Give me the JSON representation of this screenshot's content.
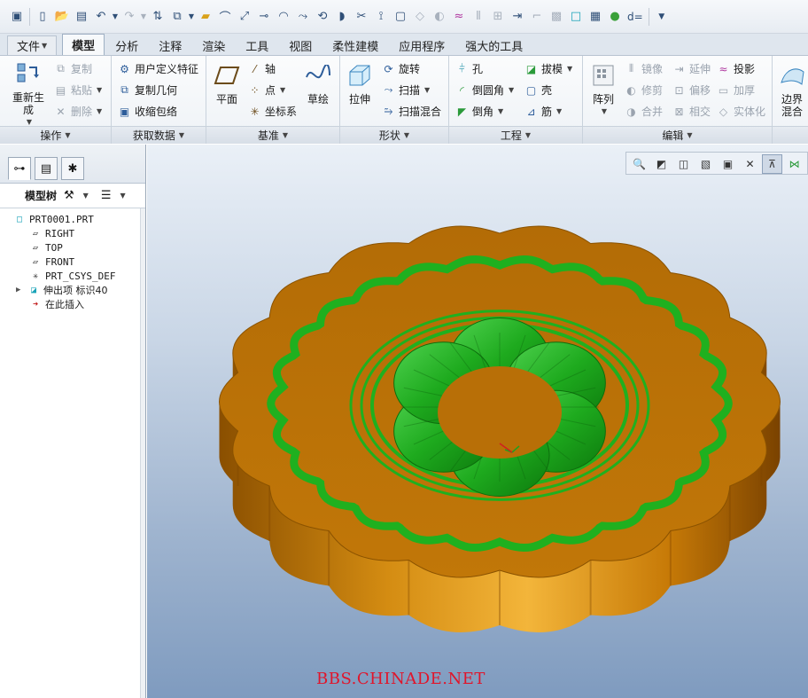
{
  "quick_access": {
    "icons": [
      "regenerate-small-icon",
      "new-icon",
      "open-icon",
      "save-icon",
      "undo-icon",
      "redo-icon",
      "regenerate-icon",
      "windows-icon",
      "folder-icon",
      "spline-icon",
      "transform-icon",
      "axis-icon",
      "surface-icon",
      "sweep-icon",
      "rotate-icon",
      "blend-icon",
      "trim-icon",
      "offset-icon",
      "copy-surf-icon",
      "wave-icon",
      "split-icon",
      "extend-icon",
      "curve-icon",
      "fill-icon",
      "cube-icon",
      "display-icon",
      "sphere-icon",
      "dimension-icon"
    ],
    "dimension_label": "d="
  },
  "tabs": [
    "文件",
    "模型",
    "分析",
    "注释",
    "渲染",
    "工具",
    "视图",
    "柔性建模",
    "应用程序",
    "强大的工具"
  ],
  "active_tab": "模型",
  "ribbon": {
    "operations": {
      "title": "操作",
      "regenerate": "重新生成",
      "copy": "复制",
      "paste": "粘贴",
      "delete": "删除"
    },
    "get_data": {
      "title": "获取数据",
      "udf": "用户定义特征",
      "copy_geom": "复制几何",
      "shrinkwrap": "收缩包络"
    },
    "datum": {
      "title": "基准",
      "plane": "平面",
      "axis": "轴",
      "point": "点",
      "csys": "坐标系",
      "sketch": "草绘"
    },
    "shapes": {
      "title": "形状",
      "extrude": "拉伸",
      "revolve": "旋转",
      "sweep": "扫描",
      "swept_blend": "扫描混合"
    },
    "engineering": {
      "title": "工程",
      "hole": "孔",
      "round": "倒圆角",
      "chamfer": "倒角",
      "draft": "拔模",
      "shell": "壳",
      "rib": "筋"
    },
    "editing": {
      "title": "编辑",
      "pattern": "阵列",
      "mirror": "镜像",
      "trim": "修剪",
      "merge": "合并",
      "extend": "延伸",
      "offset": "偏移",
      "intersect": "相交",
      "project": "投影",
      "thicken": "加厚",
      "solidify": "实体化"
    },
    "surfaces": {
      "boundary_blend": "边界混合"
    }
  },
  "model_tree": {
    "title": "模型树",
    "items": [
      {
        "label": "PRT0001.PRT",
        "icon": "part-icon"
      },
      {
        "label": "RIGHT",
        "icon": "datum-plane-icon"
      },
      {
        "label": "TOP",
        "icon": "datum-plane-icon"
      },
      {
        "label": "FRONT",
        "icon": "datum-plane-icon"
      },
      {
        "label": "PRT_CSYS_DEF",
        "icon": "csys-icon"
      },
      {
        "label": "伸出项 标识40",
        "icon": "protrusion-icon"
      },
      {
        "label": "在此插入",
        "icon": "insert-here-icon"
      }
    ]
  },
  "colors": {
    "cake_body": "#c67a06",
    "cake_top": "#b97208",
    "pattern_green": "#1fb01f",
    "watermark": "#e0152b"
  },
  "watermark": "BBS.CHINADE.NET"
}
